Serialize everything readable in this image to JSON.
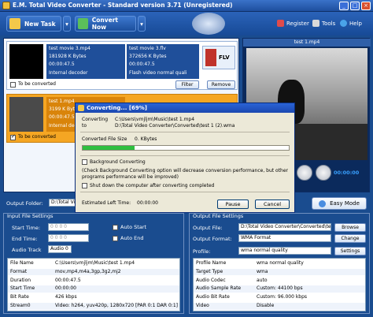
{
  "window": {
    "title": "E.M. Total Video Converter - Standard version 3.71 (Unregistered)",
    "min": "_",
    "max": "□",
    "close": "×"
  },
  "toolbar": {
    "new_task": "New Task",
    "convert_now": "Convert Now",
    "register": "Register",
    "tools": "Tools",
    "help": "Help"
  },
  "items": [
    {
      "src_name": "test movie 3.mp4",
      "src_size": "181928 K Bytes",
      "src_dur": "00:00:47.5",
      "decoder": "Internal decoder",
      "dst_name": "test movie 3.flv",
      "dst_size": "372656 K Bytes",
      "dst_dur": "00:00:47.5",
      "dst_quality": "Flash video normal quali",
      "badge": "FLV",
      "to_be_converted": "To be converted",
      "filter": "Filter",
      "remove": "Remove",
      "checked": false
    },
    {
      "src_name": "test 1.mp4",
      "src_size": "3199 K Bytes",
      "src_dur": "00:00:47.5",
      "decoder": "Internal decoder",
      "to_be_converted": "To be converted",
      "checked": true
    }
  ],
  "preview": {
    "title": "test 1.mp4",
    "time": "00:00:00"
  },
  "output_folder": {
    "label": "Output Folder:",
    "value": "D:\\Total Video Converter\\Converted"
  },
  "easy_mode": "Easy Mode",
  "dialog": {
    "title": "Converting... [69%]",
    "converting_label": "Converting",
    "to_label": "to",
    "src_path": "C:\\Users\\vmjljm\\Music\\test 1.mp4",
    "dst_path": "D:\\Total Video Converter\\Converted\\test 1 (2).wma",
    "converted_size_label": "Converted File Size",
    "converted_size": "0.  KBytes",
    "progress": 0.25,
    "background_converting": "Background Converting",
    "note": "(Check Background Converting option will decrease conversion performance, but other programs performance will be improved)",
    "shutdown": "Shut down the computer after converting completed",
    "estimated_label": "Estimated Left Time:",
    "estimated_value": "00:00:00",
    "pause": "Pause",
    "cancel": "Cancel"
  },
  "input_settings": {
    "title": "Input File Settings",
    "start_time_label": "Start Time:",
    "start_time": "0  0  0  0",
    "end_time_label": "End Time:",
    "end_time": "0  0  0  0",
    "audio_track_label": "Audio Track",
    "audio_track": "Audio 0",
    "auto_start": "Auto Start",
    "auto_end": "Auto End",
    "props": [
      [
        "File Name",
        "C:\\Users\\vmjljm\\Music\\test 1.mp4"
      ],
      [
        "Format",
        "mov,mp4,m4a,3gp,3g2,mj2"
      ],
      [
        "Duration",
        "00:00:47.5"
      ],
      [
        "Start Time",
        "00:00:00"
      ],
      [
        "Bit Rate",
        "426 kbps"
      ],
      [
        "Stream0",
        "Video: h264, yuv420p, 1280x720 [PAR 0:1 DAR 0:1]"
      ]
    ]
  },
  "output_settings": {
    "title": "Output File Settings",
    "file_label": "Output File:",
    "file": "D:\\Total Video Converter\\Converted\\test 1",
    "format_label": "Output Format:",
    "format": "WMA Format",
    "profile_label": "Profile:",
    "profile": "wma normal quality",
    "browse": "Browse",
    "change": "Change",
    "settings": "Settings",
    "props": [
      [
        "Profile Name",
        "wma normal quality"
      ],
      [
        "Target Type",
        "wma"
      ],
      [
        "Audio Codec",
        "auto"
      ],
      [
        "Audio Sample Rate",
        "Custom: 44100 bps"
      ],
      [
        "Audio Bit Rate",
        "Custom: 96.000 kbps"
      ],
      [
        "Video",
        "Disable"
      ]
    ]
  }
}
